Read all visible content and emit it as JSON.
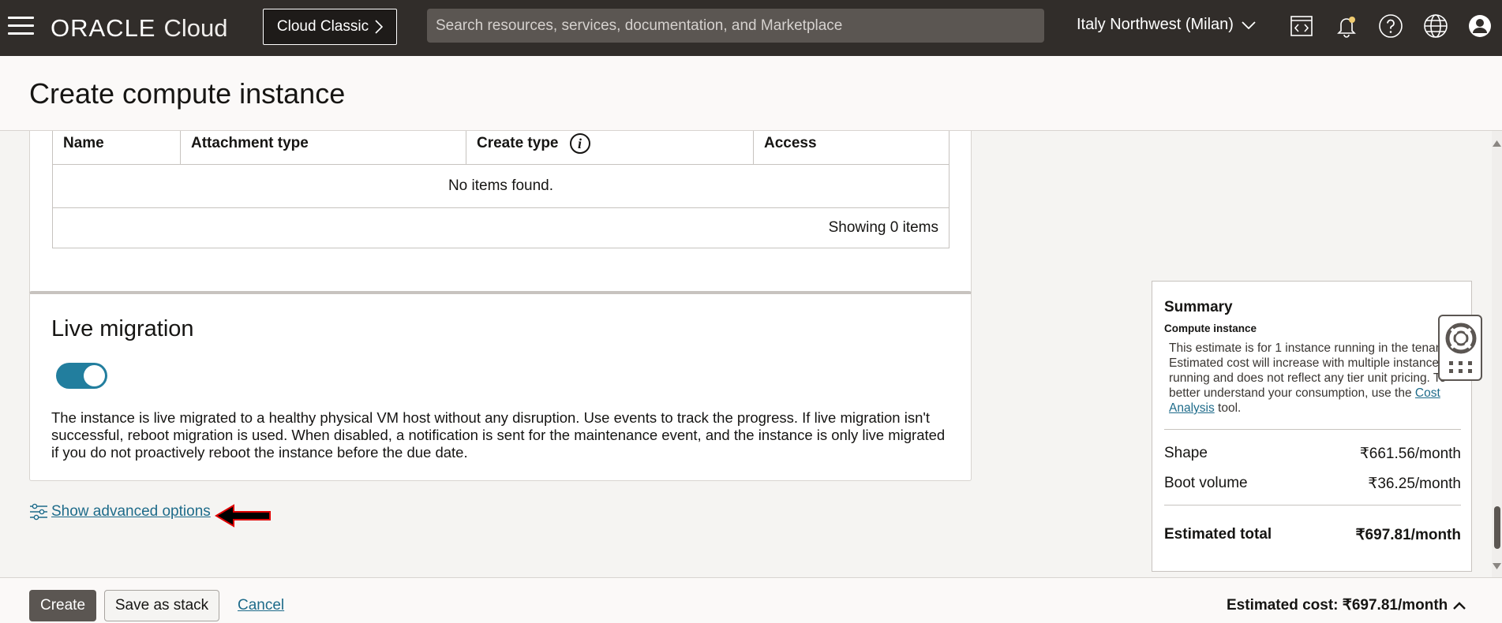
{
  "topbar": {
    "logo_oracle": "ORACLE",
    "logo_cloud": "Cloud",
    "classic_label": "Cloud Classic",
    "search_placeholder": "Search resources, services, documentation, and Marketplace",
    "region": "Italy Northwest (Milan)"
  },
  "header": {
    "title": "Create compute instance"
  },
  "attached_volumes_table": {
    "columns": [
      "Name",
      "Attachment type",
      "Create type",
      "Access"
    ],
    "empty_message": "No items found.",
    "count_text": "Showing 0 items"
  },
  "live_migration": {
    "title": "Live migration",
    "enabled": true,
    "description": "The instance is live migrated to a healthy physical VM host without any disruption. Use events to track the progress. If live migration isn't successful, reboot migration is used. When disabled, a notification is sent for the maintenance event, and the instance is only live migrated if you do not proactively reboot the instance before the due date."
  },
  "advanced_link": "Show advanced options",
  "summary": {
    "title": "Summary",
    "subtitle": "Compute instance",
    "note_before": "This estimate is for 1 instance running in the tenancy. Estimated cost will increase with multiple instances running and does not reflect any tier unit pricing. To better understand your consumption, use the ",
    "note_link": "Cost Analysis",
    "note_after": " tool.",
    "rows": [
      {
        "label": "Shape",
        "value": "₹661.56/month"
      },
      {
        "label": "Boot volume",
        "value": "₹36.25/month"
      }
    ],
    "total_label": "Estimated total",
    "total_value": "₹697.81/month"
  },
  "footer": {
    "create_label": "Create",
    "stack_label": "Save as stack",
    "cancel_label": "Cancel",
    "estimated_cost": "Estimated cost: ₹697.81/month"
  },
  "colors": {
    "accent": "#227e9e",
    "link": "#1e6b8a",
    "topbar": "#312d2a",
    "highlight_arrow": "#e00000"
  }
}
